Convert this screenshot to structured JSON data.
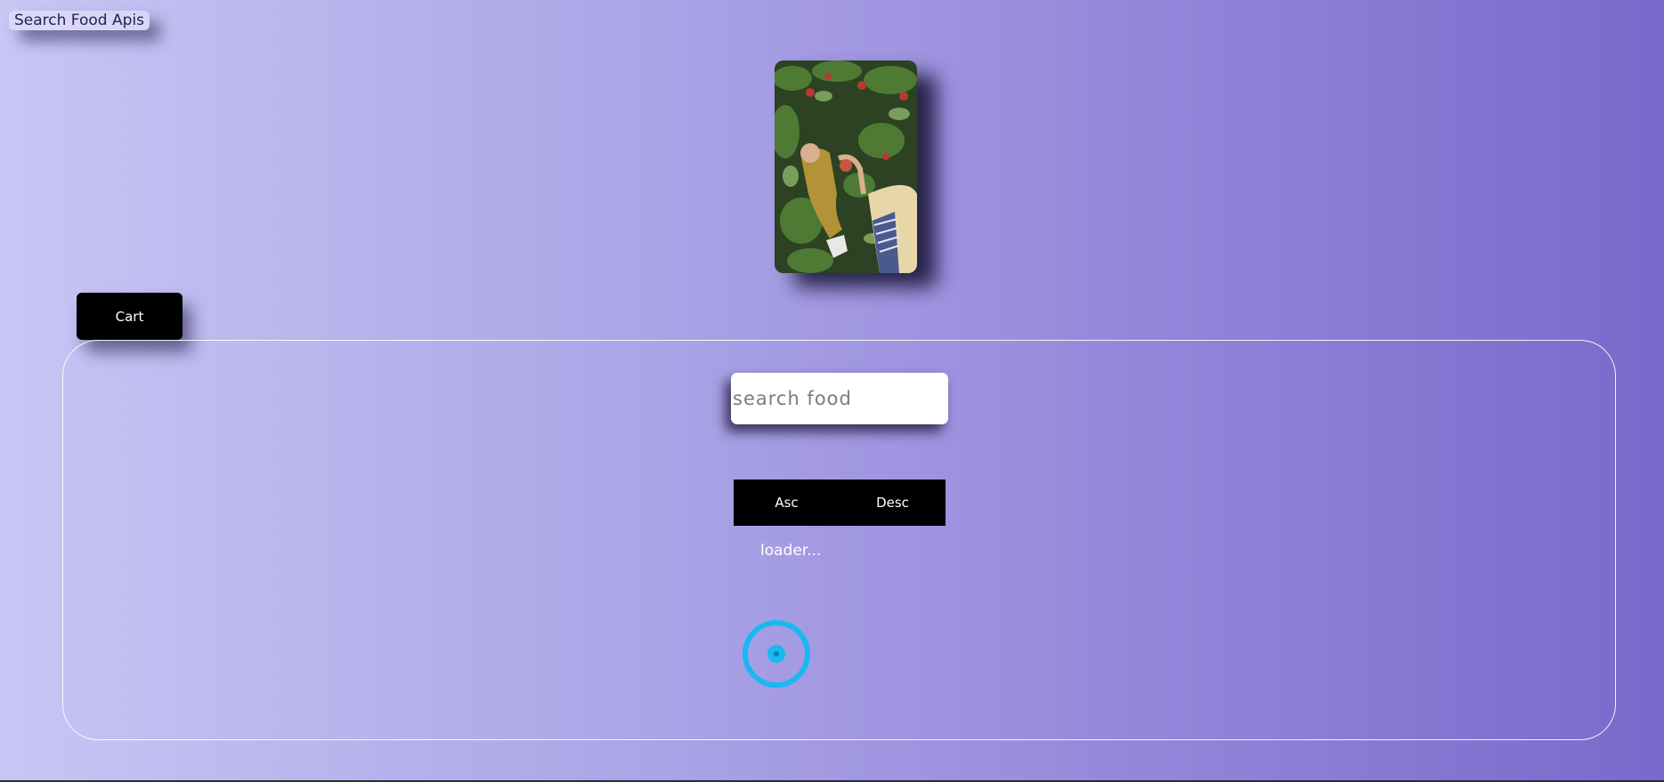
{
  "header": {
    "title": "Search Food Apis"
  },
  "hero": {
    "image_icon": "orchard-photo"
  },
  "cart": {
    "label": "Cart"
  },
  "search": {
    "placeholder": "search food",
    "value": ""
  },
  "sort": {
    "asc_label": "Asc",
    "desc_label": "Desc"
  },
  "status": {
    "loader_text": "loader..."
  },
  "spinner": {
    "icon": "loading-spinner-icon",
    "color": "#19b8f0"
  }
}
